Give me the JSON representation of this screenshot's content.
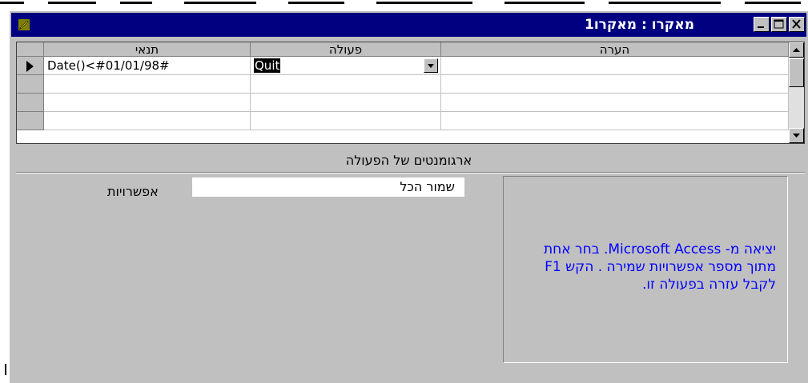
{
  "window": {
    "title": "מאקרו : מאקרו1",
    "icon": "macro-pencil-icon",
    "title_bar_color": "#000080"
  },
  "grid": {
    "columns": [
      {
        "key": "condition",
        "label": "תנאי"
      },
      {
        "key": "action",
        "label": "פעולה"
      },
      {
        "key": "comment",
        "label": "הערה"
      }
    ],
    "rows": [
      {
        "condition": "Date()<#01/01/98#",
        "action": "Quit",
        "comment": ""
      },
      {
        "condition": "",
        "action": "",
        "comment": ""
      },
      {
        "condition": "",
        "action": "",
        "comment": ""
      },
      {
        "condition": "",
        "action": "",
        "comment": ""
      }
    ]
  },
  "arguments": {
    "section_label": "ארגומנטים של הפעולה",
    "options_label": "אפשרויות",
    "options_value": "שמור הכל"
  },
  "help": {
    "text": "יציאה מ- Microsoft Access. בחר אחת מתוך מספר אפשרויות שמירה . הקש F1 לקבל עזרה בפעולה זו.",
    "color": "#0000ff"
  }
}
